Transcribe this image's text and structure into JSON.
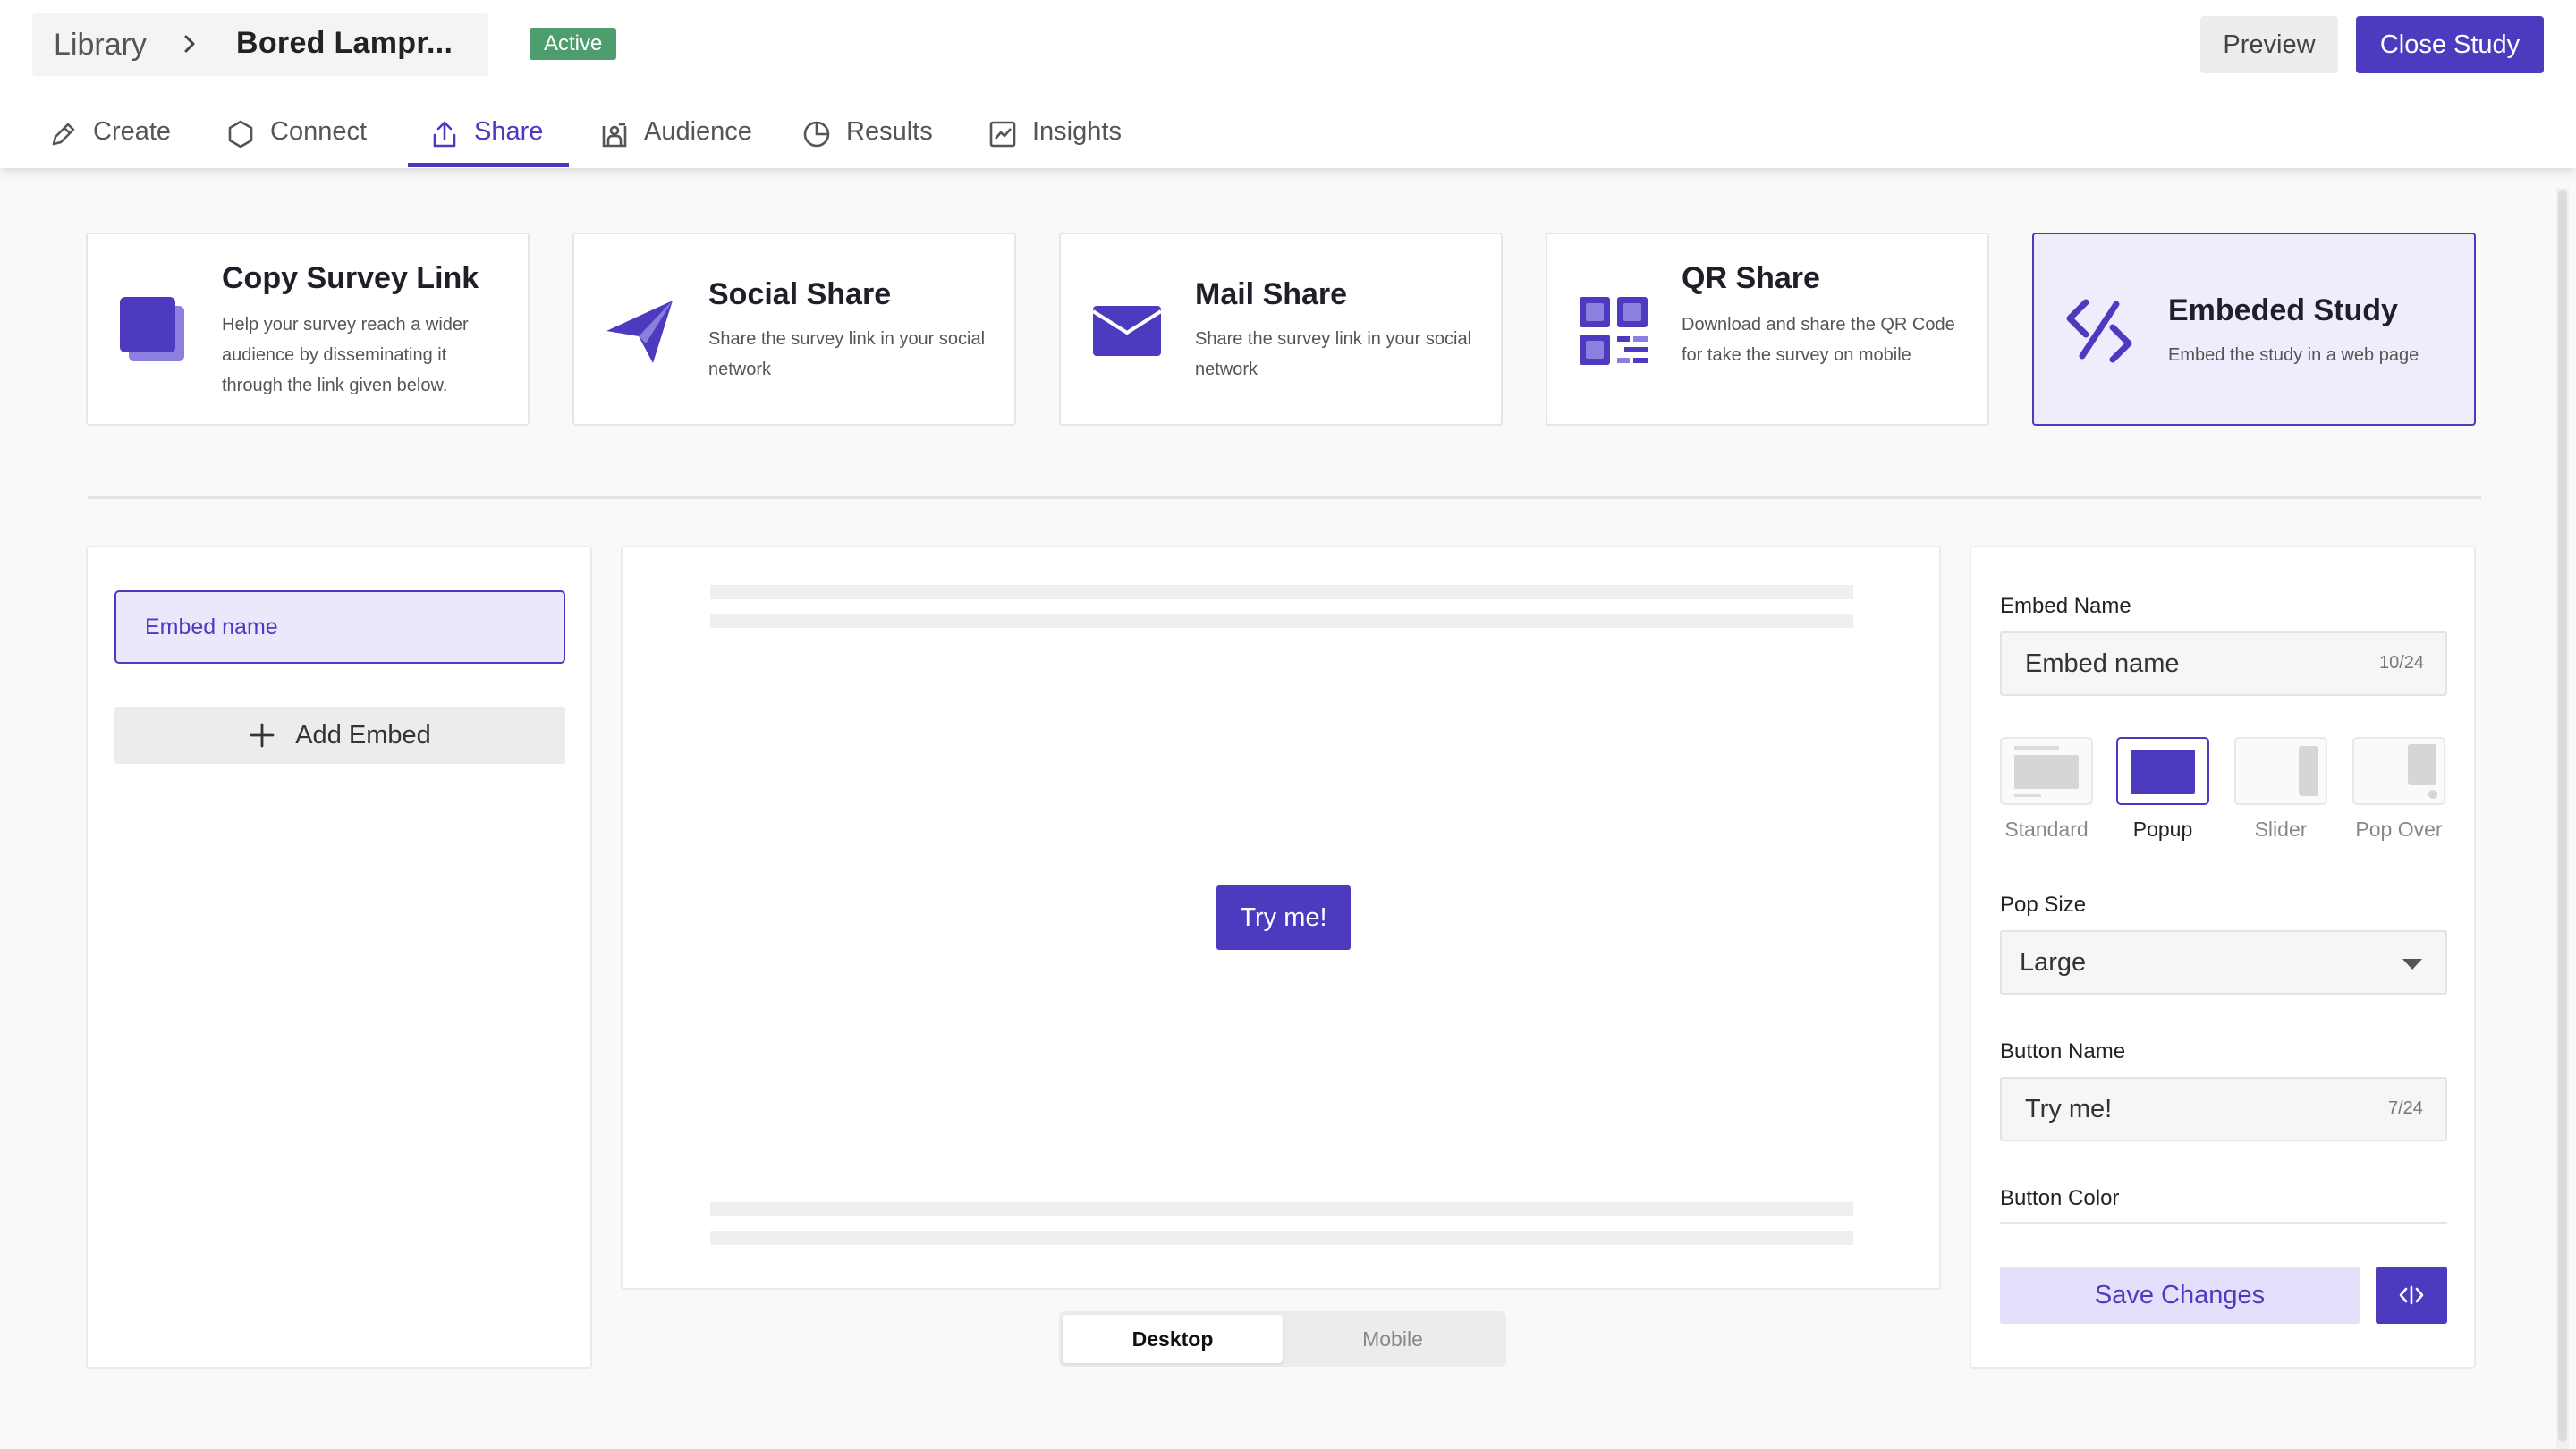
{
  "breadcrumb": {
    "library": "Library",
    "study": "Bored Lampr..."
  },
  "status": {
    "label": "Active",
    "color": "#4e9d6f"
  },
  "header_actions": {
    "preview": "Preview",
    "close_study": "Close Study"
  },
  "tabs": [
    {
      "label": "Create",
      "icon": "pencil-icon"
    },
    {
      "label": "Connect",
      "icon": "hexagon-icon"
    },
    {
      "label": "Share",
      "icon": "upload-icon",
      "active": true
    },
    {
      "label": "Audience",
      "icon": "audience-icon"
    },
    {
      "label": "Results",
      "icon": "pie-chart-icon"
    },
    {
      "label": "Insights",
      "icon": "line-chart-icon"
    }
  ],
  "share_cards": [
    {
      "title": "Copy Survey Link",
      "description": "Help your survey reach a wider audience by disseminating it through the link given below.",
      "icon": "copy-link-icon"
    },
    {
      "title": "Social Share",
      "description": "Share the survey link in your social network",
      "icon": "paper-plane-icon"
    },
    {
      "title": "Mail Share",
      "description": "Share the survey link in your social network",
      "icon": "mail-icon"
    },
    {
      "title": "QR Share",
      "description": "Download and share the QR Code for take the survey on mobile",
      "icon": "qr-code-icon"
    },
    {
      "title": "Embeded Study",
      "description": "Embed the study in a web page",
      "icon": "code-icon",
      "selected": true
    }
  ],
  "embeds": {
    "items": [
      "Embed name"
    ],
    "add_label": "Add Embed"
  },
  "preview": {
    "button_label": "Try me!"
  },
  "device_toggle": {
    "desktop": "Desktop",
    "mobile": "Mobile",
    "selected": "Desktop"
  },
  "settings": {
    "embed_name_label": "Embed Name",
    "embed_name_value": "Embed name",
    "embed_name_count": "10/24",
    "layouts": [
      {
        "label": "Standard"
      },
      {
        "label": "Popup",
        "active": true
      },
      {
        "label": "Slider"
      },
      {
        "label": "Pop Over"
      }
    ],
    "pop_size_label": "Pop Size",
    "pop_size_value": "Large",
    "button_name_label": "Button Name",
    "button_name_value": "Try me!",
    "button_name_count": "7/24",
    "button_color_label": "Button Color",
    "save_label": "Save Changes"
  },
  "colors": {
    "accent": "#4d3bbf",
    "accent_light": "#efedfb",
    "accent_soft": "#8b7fe0"
  }
}
